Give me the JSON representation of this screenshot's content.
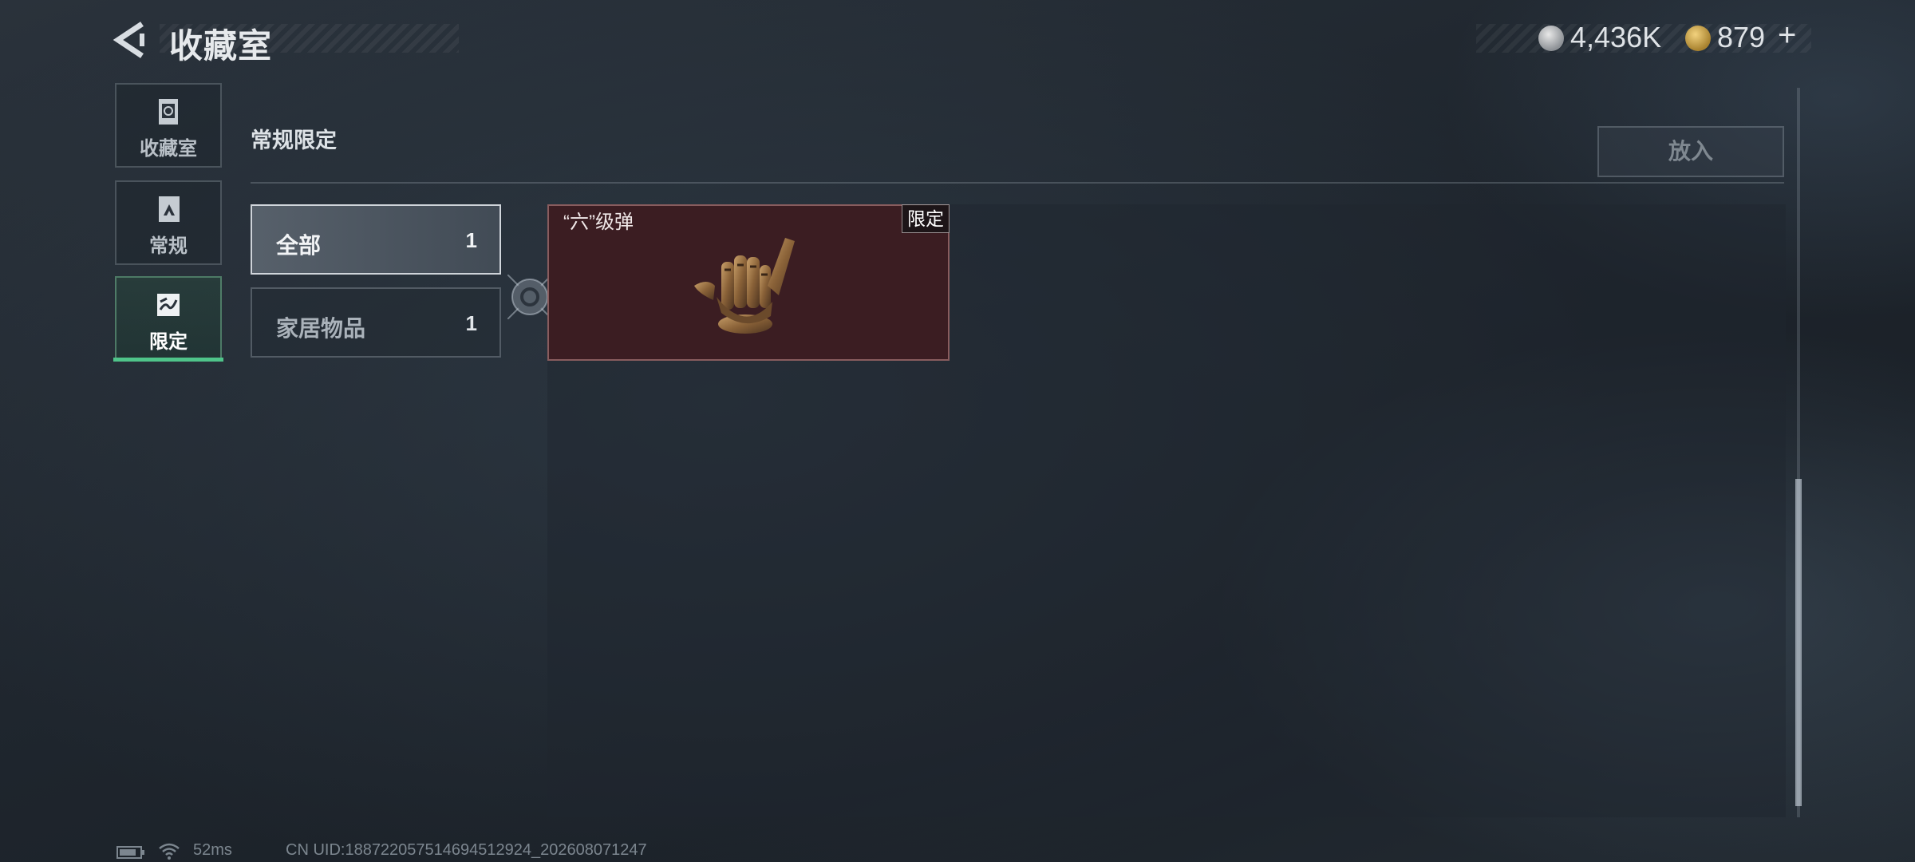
{
  "header": {
    "title": "收藏室",
    "currencies": [
      {
        "icon": "silver-coin-icon",
        "value": "4,436K"
      },
      {
        "icon": "gold-coin-icon",
        "value": "879"
      }
    ],
    "add_label": "+"
  },
  "sidebar": {
    "items": [
      {
        "label": "收藏室",
        "icon": "collection-room-icon"
      },
      {
        "label": "常规",
        "icon": "regular-icon"
      },
      {
        "label": "限定",
        "icon": "limited-icon",
        "selected": true
      }
    ]
  },
  "section": {
    "title": "常规限定",
    "place_button": "放入"
  },
  "filters": [
    {
      "label": "全部",
      "count": "1",
      "selected": true
    },
    {
      "label": "家居物品",
      "count": "1"
    }
  ],
  "items": [
    {
      "name": "“六”级弹",
      "badge": "限定",
      "image": "hand-sculpture-icon"
    }
  ],
  "status": {
    "ping": "52ms",
    "uid": "CN UID:18872205751469451292​4_202608071247"
  },
  "colors": {
    "accent": "#4fc48a",
    "item_card_bg": "#3b1d22"
  }
}
